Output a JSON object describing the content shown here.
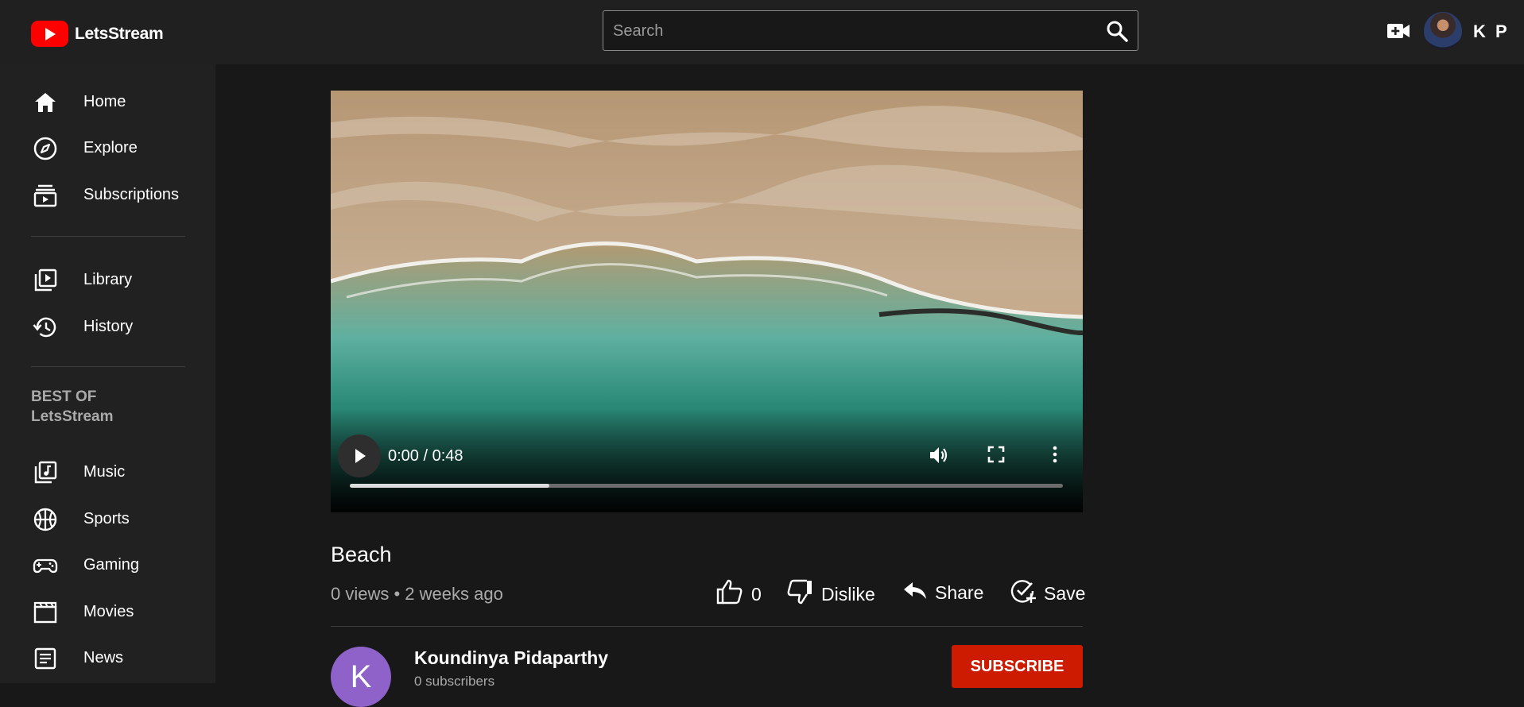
{
  "brand": {
    "name": "LetsStream"
  },
  "search": {
    "placeholder": "Search",
    "value": ""
  },
  "header": {
    "user_initials": "K P",
    "icons": [
      "search-icon",
      "video-create-icon",
      "avatar"
    ]
  },
  "sidebar": {
    "items": [
      {
        "label": "Home",
        "icon": "home-icon"
      },
      {
        "label": "Explore",
        "icon": "compass-icon"
      },
      {
        "label": "Subscriptions",
        "icon": "subscriptions-icon"
      },
      {
        "label": "Library",
        "icon": "library-icon"
      },
      {
        "label": "History",
        "icon": "history-icon"
      }
    ],
    "section_title_line1": "BEST OF",
    "section_title_line2": "LetsStream",
    "best_of": [
      {
        "label": "Music",
        "icon": "music-icon"
      },
      {
        "label": "Sports",
        "icon": "sports-icon"
      },
      {
        "label": "Gaming",
        "icon": "gamepad-icon"
      },
      {
        "label": "Movies",
        "icon": "movies-icon"
      },
      {
        "label": "News",
        "icon": "news-icon"
      }
    ]
  },
  "player": {
    "time": "0:00 / 0:48",
    "progress": 0.28,
    "icons": [
      "play-icon",
      "volume-icon",
      "fullscreen-icon",
      "more-vert-icon"
    ]
  },
  "video": {
    "title": "Beach",
    "meta": "0 views • 2 weeks ago",
    "likes": "0",
    "dislike_label": "Dislike",
    "share_label": "Share",
    "save_label": "Save"
  },
  "channel": {
    "initial": "K",
    "name": "Koundinya Pidaparthy",
    "subscribers": "0 subscribers",
    "subscribe_label": "SUBSCRIBE"
  },
  "colors": {
    "accent": "#ff0000",
    "subscribe": "#cc1b00",
    "avatar": "#8e62c8",
    "background": "#181818",
    "header": "#202020"
  }
}
